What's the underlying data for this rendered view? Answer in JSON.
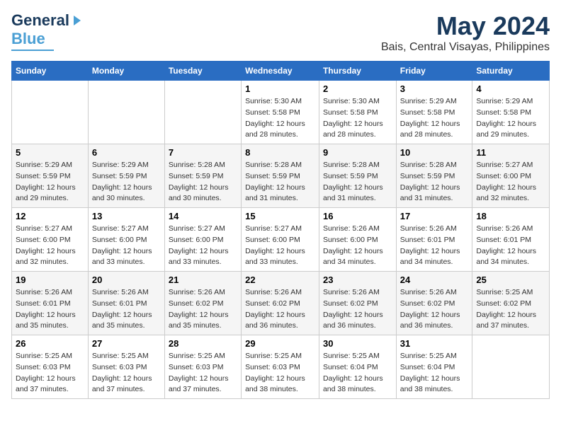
{
  "header": {
    "logo_line1": "General",
    "logo_line2": "Blue",
    "month": "May 2024",
    "location": "Bais, Central Visayas, Philippines"
  },
  "weekdays": [
    "Sunday",
    "Monday",
    "Tuesday",
    "Wednesday",
    "Thursday",
    "Friday",
    "Saturday"
  ],
  "weeks": [
    [
      {
        "day": "",
        "sunrise": "",
        "sunset": "",
        "daylight": ""
      },
      {
        "day": "",
        "sunrise": "",
        "sunset": "",
        "daylight": ""
      },
      {
        "day": "",
        "sunrise": "",
        "sunset": "",
        "daylight": ""
      },
      {
        "day": "1",
        "sunrise": "Sunrise: 5:30 AM",
        "sunset": "Sunset: 5:58 PM",
        "daylight": "Daylight: 12 hours and 28 minutes."
      },
      {
        "day": "2",
        "sunrise": "Sunrise: 5:30 AM",
        "sunset": "Sunset: 5:58 PM",
        "daylight": "Daylight: 12 hours and 28 minutes."
      },
      {
        "day": "3",
        "sunrise": "Sunrise: 5:29 AM",
        "sunset": "Sunset: 5:58 PM",
        "daylight": "Daylight: 12 hours and 28 minutes."
      },
      {
        "day": "4",
        "sunrise": "Sunrise: 5:29 AM",
        "sunset": "Sunset: 5:58 PM",
        "daylight": "Daylight: 12 hours and 29 minutes."
      }
    ],
    [
      {
        "day": "5",
        "sunrise": "Sunrise: 5:29 AM",
        "sunset": "Sunset: 5:59 PM",
        "daylight": "Daylight: 12 hours and 29 minutes."
      },
      {
        "day": "6",
        "sunrise": "Sunrise: 5:29 AM",
        "sunset": "Sunset: 5:59 PM",
        "daylight": "Daylight: 12 hours and 30 minutes."
      },
      {
        "day": "7",
        "sunrise": "Sunrise: 5:28 AM",
        "sunset": "Sunset: 5:59 PM",
        "daylight": "Daylight: 12 hours and 30 minutes."
      },
      {
        "day": "8",
        "sunrise": "Sunrise: 5:28 AM",
        "sunset": "Sunset: 5:59 PM",
        "daylight": "Daylight: 12 hours and 31 minutes."
      },
      {
        "day": "9",
        "sunrise": "Sunrise: 5:28 AM",
        "sunset": "Sunset: 5:59 PM",
        "daylight": "Daylight: 12 hours and 31 minutes."
      },
      {
        "day": "10",
        "sunrise": "Sunrise: 5:28 AM",
        "sunset": "Sunset: 5:59 PM",
        "daylight": "Daylight: 12 hours and 31 minutes."
      },
      {
        "day": "11",
        "sunrise": "Sunrise: 5:27 AM",
        "sunset": "Sunset: 6:00 PM",
        "daylight": "Daylight: 12 hours and 32 minutes."
      }
    ],
    [
      {
        "day": "12",
        "sunrise": "Sunrise: 5:27 AM",
        "sunset": "Sunset: 6:00 PM",
        "daylight": "Daylight: 12 hours and 32 minutes."
      },
      {
        "day": "13",
        "sunrise": "Sunrise: 5:27 AM",
        "sunset": "Sunset: 6:00 PM",
        "daylight": "Daylight: 12 hours and 33 minutes."
      },
      {
        "day": "14",
        "sunrise": "Sunrise: 5:27 AM",
        "sunset": "Sunset: 6:00 PM",
        "daylight": "Daylight: 12 hours and 33 minutes."
      },
      {
        "day": "15",
        "sunrise": "Sunrise: 5:27 AM",
        "sunset": "Sunset: 6:00 PM",
        "daylight": "Daylight: 12 hours and 33 minutes."
      },
      {
        "day": "16",
        "sunrise": "Sunrise: 5:26 AM",
        "sunset": "Sunset: 6:00 PM",
        "daylight": "Daylight: 12 hours and 34 minutes."
      },
      {
        "day": "17",
        "sunrise": "Sunrise: 5:26 AM",
        "sunset": "Sunset: 6:01 PM",
        "daylight": "Daylight: 12 hours and 34 minutes."
      },
      {
        "day": "18",
        "sunrise": "Sunrise: 5:26 AM",
        "sunset": "Sunset: 6:01 PM",
        "daylight": "Daylight: 12 hours and 34 minutes."
      }
    ],
    [
      {
        "day": "19",
        "sunrise": "Sunrise: 5:26 AM",
        "sunset": "Sunset: 6:01 PM",
        "daylight": "Daylight: 12 hours and 35 minutes."
      },
      {
        "day": "20",
        "sunrise": "Sunrise: 5:26 AM",
        "sunset": "Sunset: 6:01 PM",
        "daylight": "Daylight: 12 hours and 35 minutes."
      },
      {
        "day": "21",
        "sunrise": "Sunrise: 5:26 AM",
        "sunset": "Sunset: 6:02 PM",
        "daylight": "Daylight: 12 hours and 35 minutes."
      },
      {
        "day": "22",
        "sunrise": "Sunrise: 5:26 AM",
        "sunset": "Sunset: 6:02 PM",
        "daylight": "Daylight: 12 hours and 36 minutes."
      },
      {
        "day": "23",
        "sunrise": "Sunrise: 5:26 AM",
        "sunset": "Sunset: 6:02 PM",
        "daylight": "Daylight: 12 hours and 36 minutes."
      },
      {
        "day": "24",
        "sunrise": "Sunrise: 5:26 AM",
        "sunset": "Sunset: 6:02 PM",
        "daylight": "Daylight: 12 hours and 36 minutes."
      },
      {
        "day": "25",
        "sunrise": "Sunrise: 5:25 AM",
        "sunset": "Sunset: 6:02 PM",
        "daylight": "Daylight: 12 hours and 37 minutes."
      }
    ],
    [
      {
        "day": "26",
        "sunrise": "Sunrise: 5:25 AM",
        "sunset": "Sunset: 6:03 PM",
        "daylight": "Daylight: 12 hours and 37 minutes."
      },
      {
        "day": "27",
        "sunrise": "Sunrise: 5:25 AM",
        "sunset": "Sunset: 6:03 PM",
        "daylight": "Daylight: 12 hours and 37 minutes."
      },
      {
        "day": "28",
        "sunrise": "Sunrise: 5:25 AM",
        "sunset": "Sunset: 6:03 PM",
        "daylight": "Daylight: 12 hours and 37 minutes."
      },
      {
        "day": "29",
        "sunrise": "Sunrise: 5:25 AM",
        "sunset": "Sunset: 6:03 PM",
        "daylight": "Daylight: 12 hours and 38 minutes."
      },
      {
        "day": "30",
        "sunrise": "Sunrise: 5:25 AM",
        "sunset": "Sunset: 6:04 PM",
        "daylight": "Daylight: 12 hours and 38 minutes."
      },
      {
        "day": "31",
        "sunrise": "Sunrise: 5:25 AM",
        "sunset": "Sunset: 6:04 PM",
        "daylight": "Daylight: 12 hours and 38 minutes."
      },
      {
        "day": "",
        "sunrise": "",
        "sunset": "",
        "daylight": ""
      }
    ]
  ]
}
